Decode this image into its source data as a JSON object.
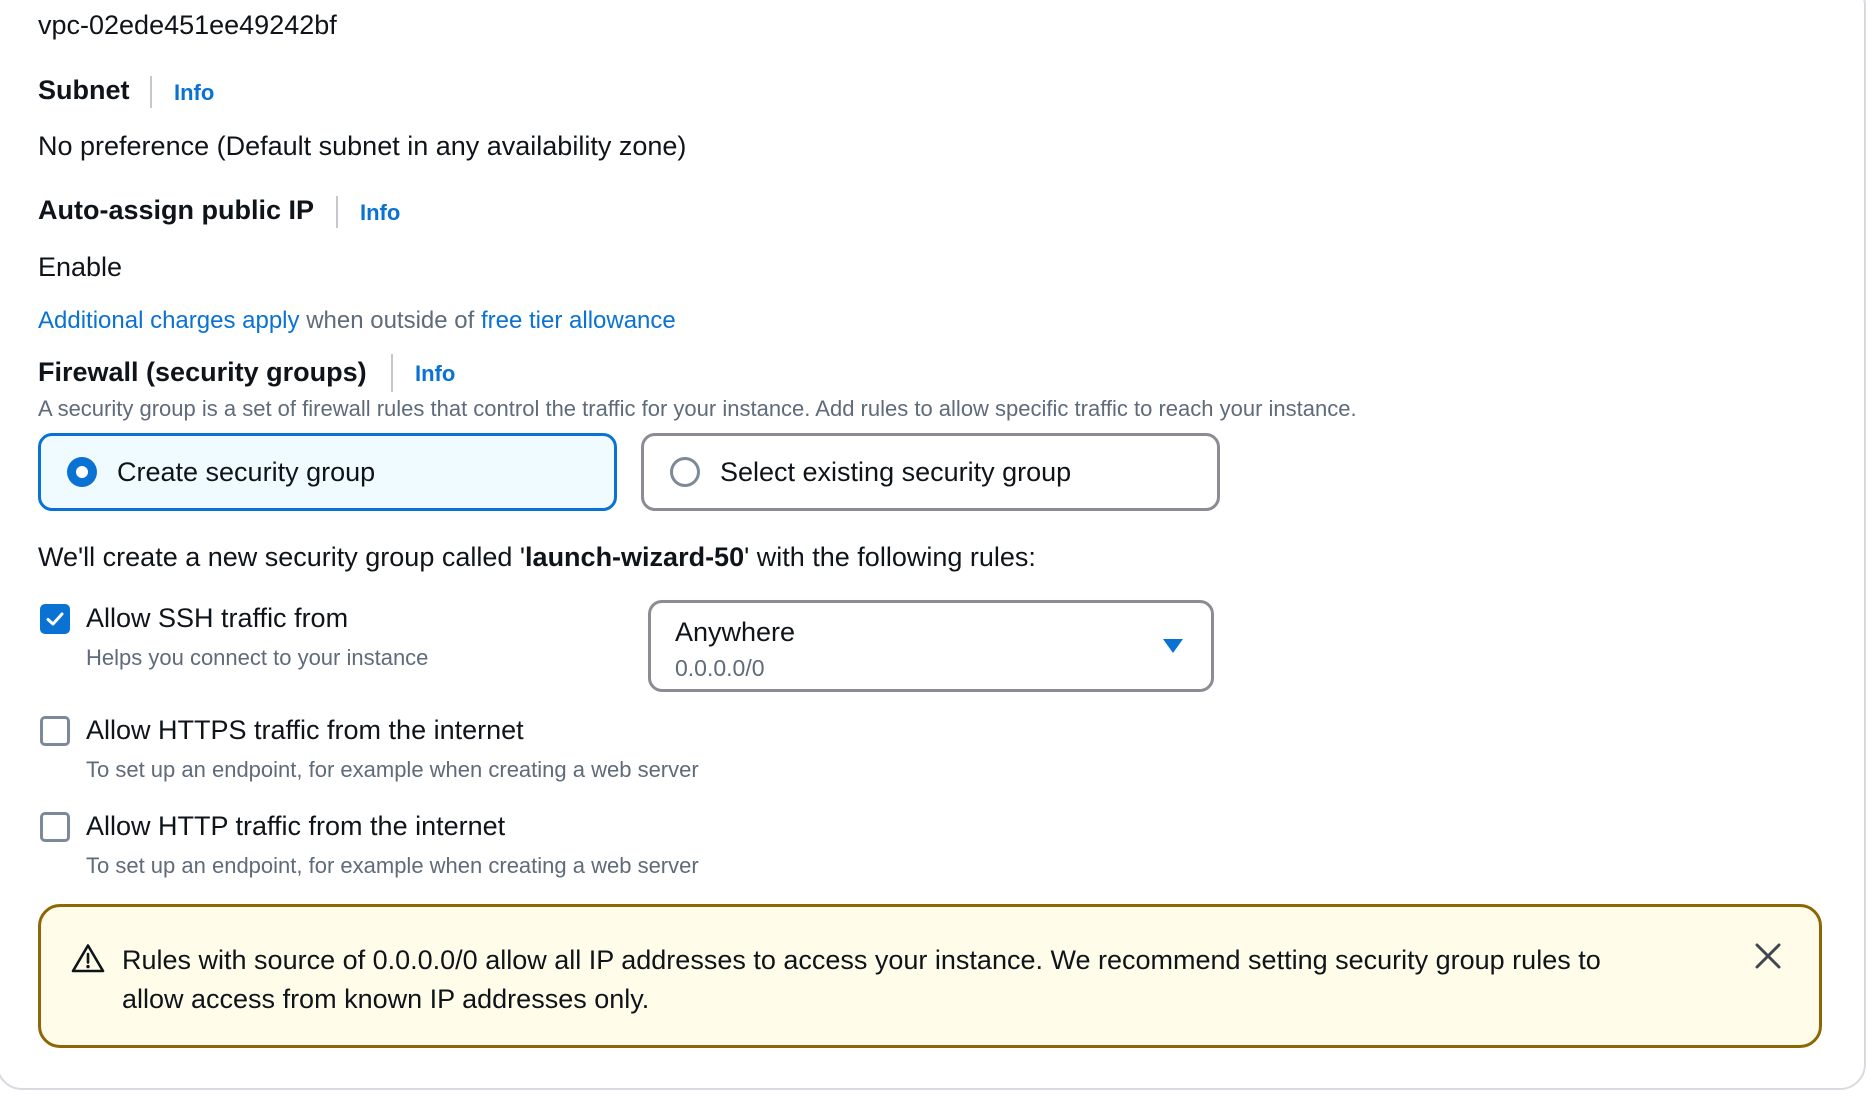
{
  "vpc": {
    "value": "vpc-02ede451ee49242bf"
  },
  "subnet": {
    "label": "Subnet",
    "info": "Info",
    "value": "No preference (Default subnet in any availability zone)"
  },
  "auto_ip": {
    "label": "Auto-assign public IP",
    "info": "Info",
    "value": "Enable",
    "charges_link": "Additional charges apply",
    "charges_mid": "when outside of",
    "free_tier_link": "free tier allowance"
  },
  "firewall": {
    "label": "Firewall (security groups)",
    "info": "Info",
    "description": "A security group is a set of firewall rules that control the traffic for your instance. Add rules to allow specific traffic to reach your instance.",
    "options": [
      {
        "label": "Create security group",
        "selected": true
      },
      {
        "label": "Select existing security group",
        "selected": false
      }
    ],
    "new_group_prefix": "We'll create a new security group called '",
    "new_group_name": "launch-wizard-50",
    "new_group_suffix": "' with the following rules:"
  },
  "rules": [
    {
      "label": "Allow SSH traffic from",
      "description": "Helps you connect to your instance",
      "checked": true
    },
    {
      "label": "Allow HTTPS traffic from the internet",
      "description": "To set up an endpoint, for example when creating a web server",
      "checked": false
    },
    {
      "label": "Allow HTTP traffic from the internet",
      "description": "To set up an endpoint, for example when creating a web server",
      "checked": false
    }
  ],
  "ssh_source": {
    "selected": "Anywhere",
    "detail": "0.0.0.0/0"
  },
  "alert": {
    "type": "warning",
    "line1": "Rules with source of 0.0.0.0/0 allow all IP addresses to access your instance. We recommend setting security group rules to",
    "line2": "allow access from known IP addresses only."
  },
  "colors": {
    "link": "#0972d3",
    "warning_border": "#8d6605",
    "warning_bg": "#fffce9"
  },
  "icons": {
    "radio_selected": "radio-selected-icon",
    "checkbox_checked": "check-icon",
    "dropdown": "caret-down-icon",
    "warning": "warning-icon",
    "dismiss": "close-icon"
  }
}
